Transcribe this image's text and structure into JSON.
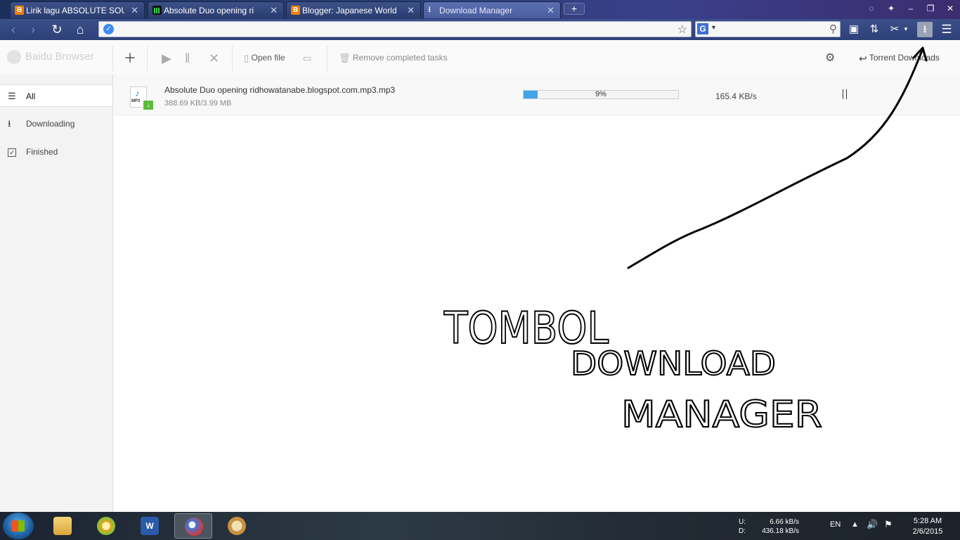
{
  "tabs": [
    {
      "title": "Lirik lagu ABSOLUTE SOU",
      "favicon": "blogger-icon"
    },
    {
      "title": "Absolute Duo opening ri",
      "favicon": "audio-equalizer-icon"
    },
    {
      "title": "Blogger: Japanese World",
      "favicon": "blogger-icon"
    },
    {
      "title": "Download Manager",
      "favicon": "download-icon",
      "active": true
    }
  ],
  "new_tab_label": "+",
  "address": {
    "value": ""
  },
  "search": {
    "engine": "G",
    "value": ""
  },
  "dm_toolbar": {
    "brand": "Baidu Browser",
    "open_file": "Open file",
    "remove_completed": "Remove completed tasks",
    "torrent_downloads": "Torrent Downloads"
  },
  "sidebar": {
    "items": [
      {
        "label": "All"
      },
      {
        "label": "Downloading"
      },
      {
        "label": "Finished"
      }
    ]
  },
  "download": {
    "file_name": "Absolute Duo opening ridhowatanabe.blogspot.com.mp3.mp3",
    "size_progress": "388.69 KB/3.99 MB",
    "percent_label": "9%",
    "percent": 9,
    "speed": "165.4 KB/s",
    "file_type": "MP3"
  },
  "taskbar": {
    "net_up_label": "U:",
    "net_up": "6.66 kB/s",
    "net_down_label": "D:",
    "net_down": "436.18 kB/s",
    "language": "EN",
    "time": "5:28 AM",
    "date": "2/6/2015"
  },
  "annotation": {
    "line1": "TOMBOL",
    "line2": "DOWNLOAD",
    "line3": "MANAGER"
  },
  "colors": {
    "progress_fill": "#43a3ea",
    "tabstrip": "#2b3f78",
    "annotation_ink": "#000000"
  }
}
